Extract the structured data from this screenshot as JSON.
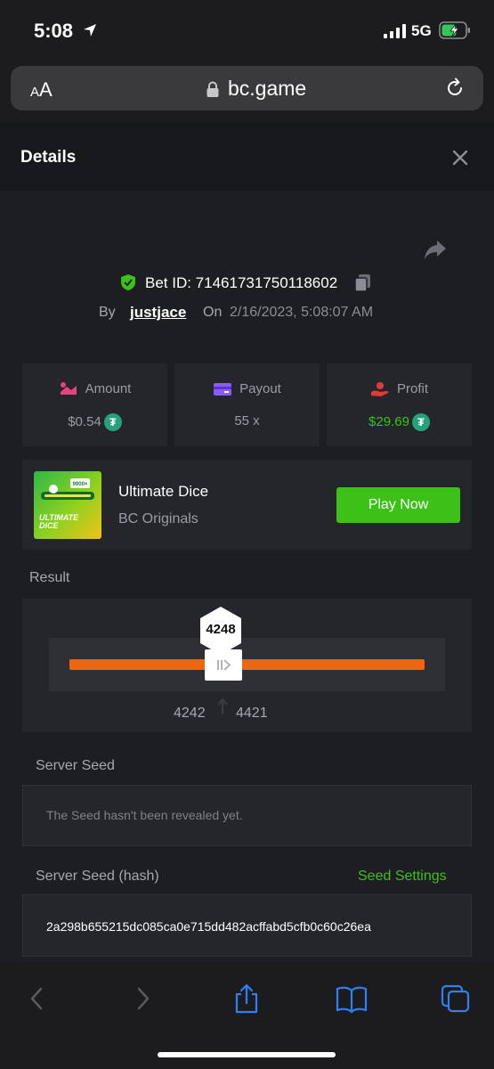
{
  "status_bar": {
    "time": "5:08",
    "network": "5G"
  },
  "browser": {
    "aa_small": "A",
    "aa_large": "A",
    "url": "bc.game"
  },
  "details": {
    "title": "Details",
    "bet_id_label": "Bet ID: 71461731750118602",
    "by_label": "By",
    "username": "justjace",
    "on_label": "On",
    "date": "2/16/2023, 5:08:07 AM"
  },
  "stats": {
    "amount": {
      "label": "Amount",
      "value": "$0.54",
      "color": "#e8437c"
    },
    "payout": {
      "label": "Payout",
      "value": "55 x",
      "color": "#8a5cff"
    },
    "profit": {
      "label": "Profit",
      "value": "$29.69",
      "color": "#e03b3b"
    }
  },
  "game": {
    "name": "Ultimate Dice",
    "provider": "BC Originals",
    "thumb_line1": "ULTIMATE",
    "thumb_line2": "DICE",
    "thumb_badge": "9900×",
    "play_label": "Play Now"
  },
  "result": {
    "label": "Result",
    "value": "4248",
    "range_low": "4242",
    "range_high": "4421",
    "accent": "#ec6610"
  },
  "server_seed": {
    "label": "Server Seed",
    "message": "The Seed hasn't been revealed yet."
  },
  "server_seed_hash": {
    "label": "Server Seed (hash)",
    "settings_link": "Seed Settings",
    "hash": "2a298b655215dc085ca0e715dd482acffabd5cfb0c60c26ea"
  },
  "colors": {
    "green": "#3bc117",
    "ios_blue": "#2f7ff5",
    "usdt": "#26a17b"
  }
}
